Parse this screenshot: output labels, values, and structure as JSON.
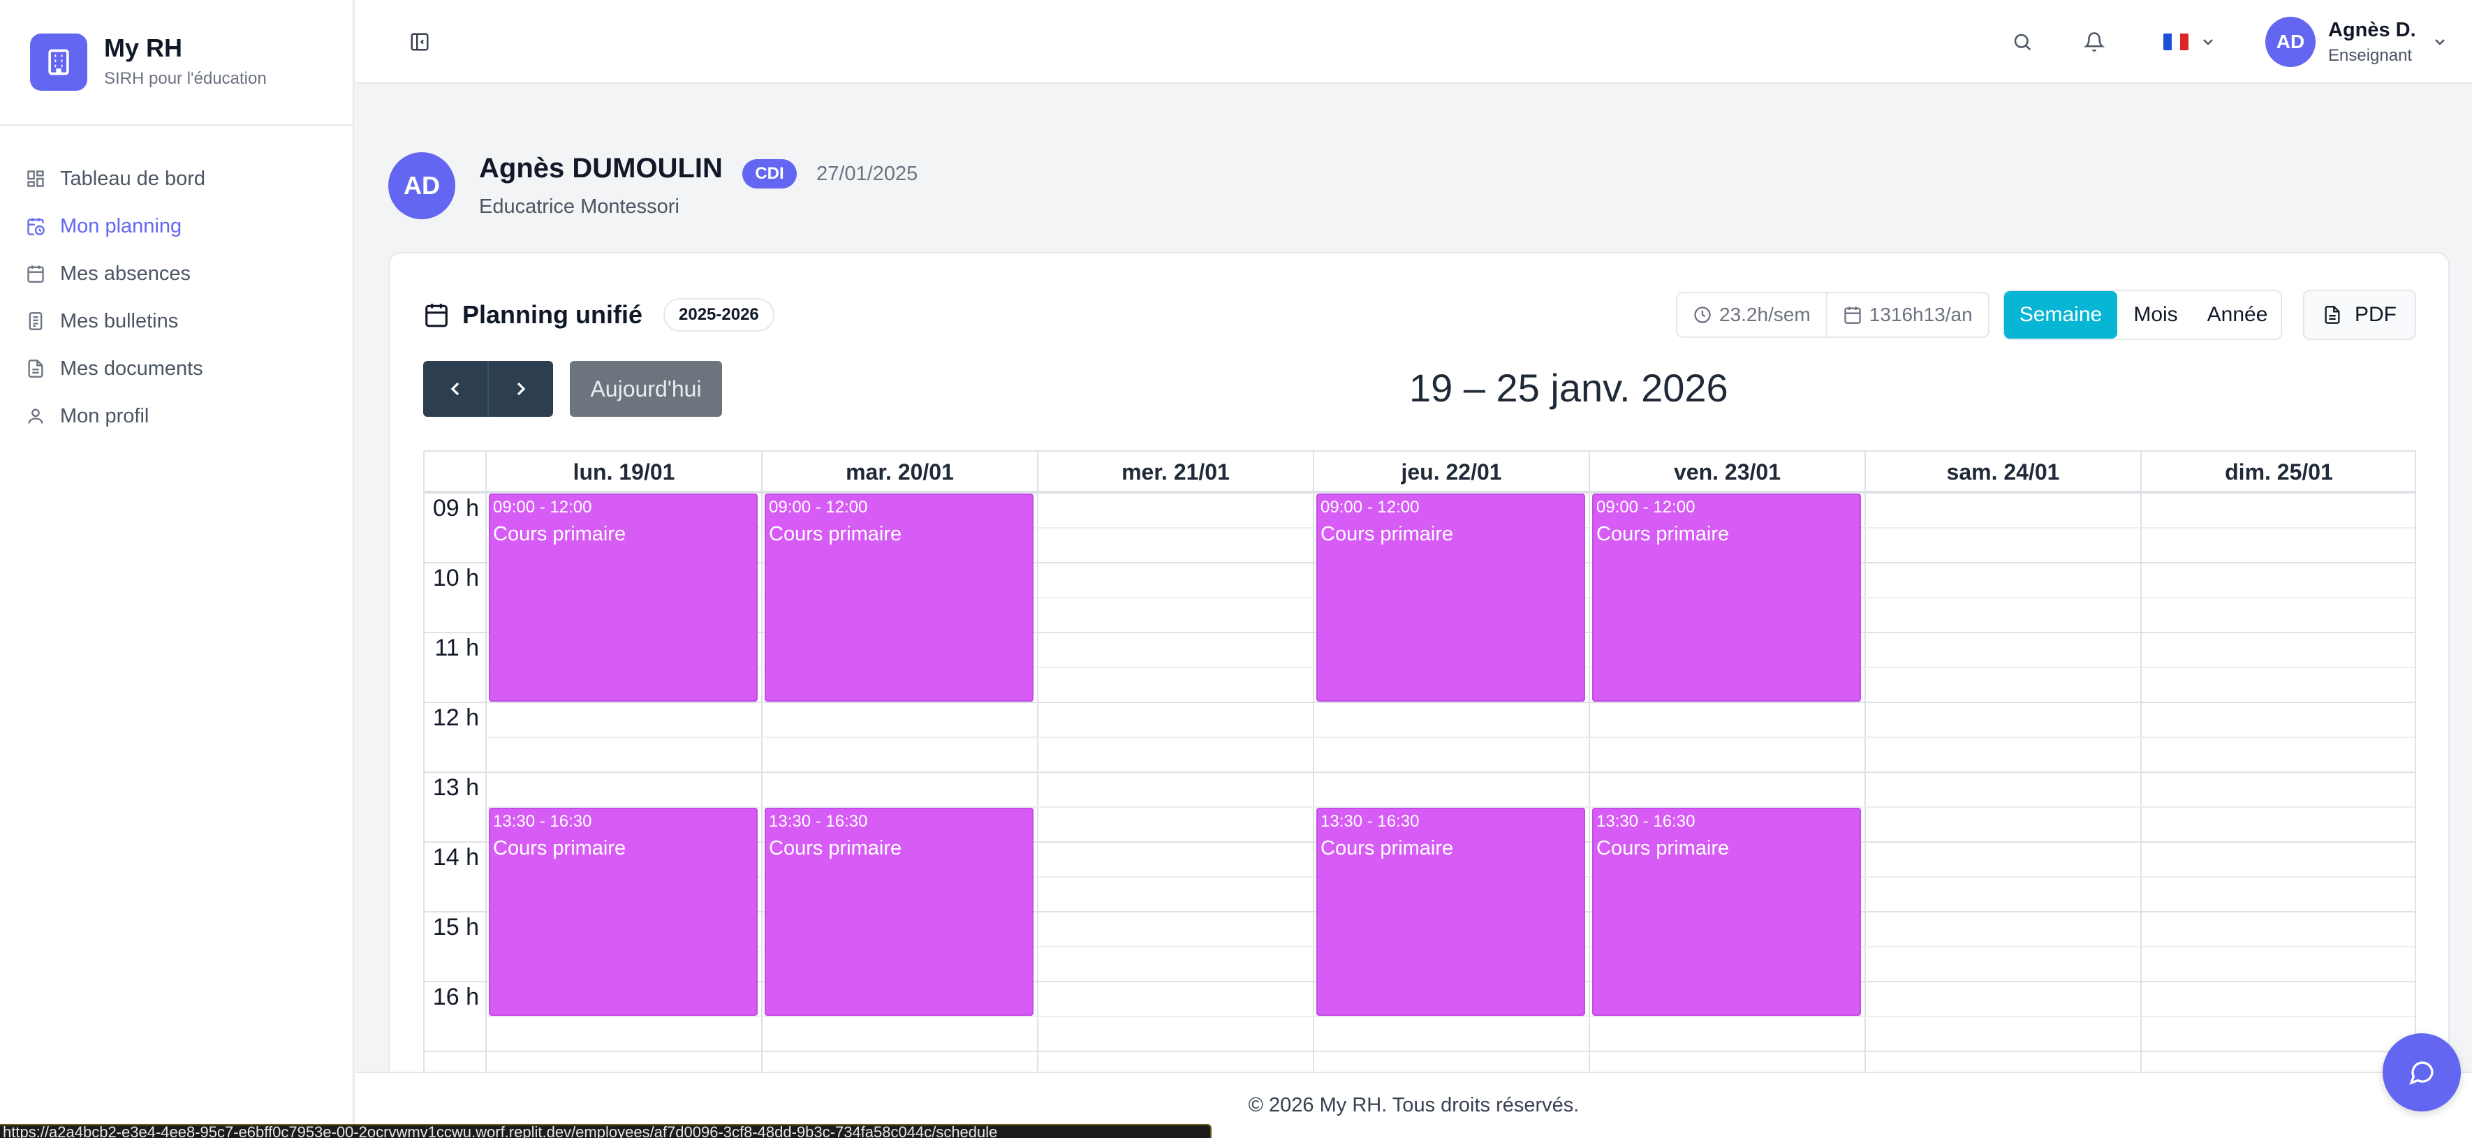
{
  "brand": {
    "name": "My RH",
    "subtitle": "SIRH pour l'éducation"
  },
  "sidebar": {
    "items": [
      {
        "label": "Tableau de bord",
        "icon": "dashboard-icon",
        "active": false
      },
      {
        "label": "Mon planning",
        "icon": "calendar-clock-icon",
        "active": true
      },
      {
        "label": "Mes absences",
        "icon": "calendar-icon",
        "active": false
      },
      {
        "label": "Mes bulletins",
        "icon": "payslip-icon",
        "active": false
      },
      {
        "label": "Mes documents",
        "icon": "document-icon",
        "active": false
      },
      {
        "label": "Mon profil",
        "icon": "user-icon",
        "active": false
      }
    ]
  },
  "header": {
    "user_initials": "AD",
    "user_name": "Agnès D.",
    "user_role": "Enseignant",
    "language_flag": "FR"
  },
  "profile": {
    "initials": "AD",
    "name": "Agnès DUMOULIN",
    "contract": "CDI",
    "date": "27/01/2025",
    "role": "Educatrice Montessori"
  },
  "planning": {
    "title": "Planning unifié",
    "year": "2025-2026",
    "hours_week": "23.2h/sem",
    "hours_year": "1316h13/an",
    "views": [
      "Semaine",
      "Mois",
      "Année"
    ],
    "active_view": "Semaine",
    "pdf_label": "PDF",
    "today_label": "Aujourd'hui",
    "range_title": "19 – 25 janv. 2026",
    "days": [
      "lun. 19/01",
      "mar. 20/01",
      "mer. 21/01",
      "jeu. 22/01",
      "ven. 23/01",
      "sam. 24/01",
      "dim. 25/01"
    ],
    "hours": [
      "09 h",
      "10 h",
      "11 h",
      "12 h",
      "13 h",
      "14 h",
      "15 h",
      "16 h"
    ],
    "events": [
      {
        "day": 0,
        "time": "09:00 - 12:00",
        "title": "Cours primaire"
      },
      {
        "day": 1,
        "time": "09:00 - 12:00",
        "title": "Cours primaire"
      },
      {
        "day": 3,
        "time": "09:00 - 12:00",
        "title": "Cours primaire"
      },
      {
        "day": 4,
        "time": "09:00 - 12:00",
        "title": "Cours primaire"
      },
      {
        "day": 0,
        "time": "13:30 - 16:30",
        "title": "Cours primaire"
      },
      {
        "day": 1,
        "time": "13:30 - 16:30",
        "title": "Cours primaire"
      },
      {
        "day": 3,
        "time": "13:30 - 16:30",
        "title": "Cours primaire"
      },
      {
        "day": 4,
        "time": "13:30 - 16:30",
        "title": "Cours primaire"
      }
    ],
    "event_color": "#d65cf5"
  },
  "footer": {
    "text": "© 2026 My RH. Tous droits réservés."
  },
  "status_url": "https://a2a4bcb2-e3e4-4ee8-95c7-e6bff0c7953e-00-2ocrvwmv1ccwu.worf.replit.dev/employees/af7d0096-3cf8-48dd-9b3c-734fa58c044c/schedule"
}
